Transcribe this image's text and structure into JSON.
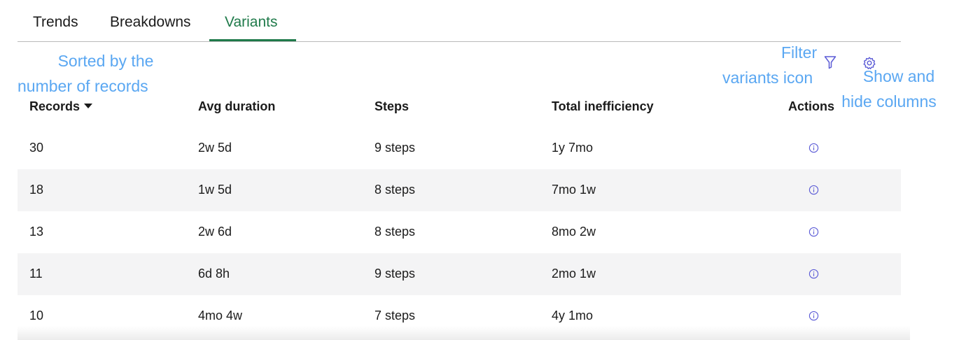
{
  "tabs": [
    {
      "label": "Trends",
      "active": false
    },
    {
      "label": "Breakdowns",
      "active": false
    },
    {
      "label": "Variants",
      "active": true
    }
  ],
  "annotations": {
    "sorted_line1": "Sorted by the",
    "sorted_line2": "number of records",
    "filter_line1": "Filter",
    "filter_line2": "variants icon",
    "columns_line1": "Show and",
    "columns_line2": "hide columns"
  },
  "toolbar": {
    "filter_icon": "filter-funnel-icon",
    "settings_icon": "gear-icon"
  },
  "table": {
    "columns": [
      "Records",
      "Avg duration",
      "Steps",
      "Total inefficiency",
      "Actions"
    ],
    "sort_column": "Records",
    "sort_direction": "descending",
    "rows": [
      {
        "records": "30",
        "avg_duration": "2w 5d",
        "steps": "9 steps",
        "total_inefficiency": "1y 7mo"
      },
      {
        "records": "18",
        "avg_duration": "1w 5d",
        "steps": "8 steps",
        "total_inefficiency": "7mo 1w"
      },
      {
        "records": "13",
        "avg_duration": "2w 6d",
        "steps": "8 steps",
        "total_inefficiency": "8mo 2w"
      },
      {
        "records": "11",
        "avg_duration": "6d 8h",
        "steps": "9 steps",
        "total_inefficiency": "2mo 1w"
      },
      {
        "records": "10",
        "avg_duration": "4mo 4w",
        "steps": "7 steps",
        "total_inefficiency": "4y 1mo"
      }
    ],
    "action_icon": "info-icon"
  },
  "colors": {
    "accent_green": "#1f7a4a",
    "annotation_blue": "#5aa7f2",
    "info_icon_purple": "#5b5bd6",
    "row_alt_bg": "#f4f4f5"
  }
}
